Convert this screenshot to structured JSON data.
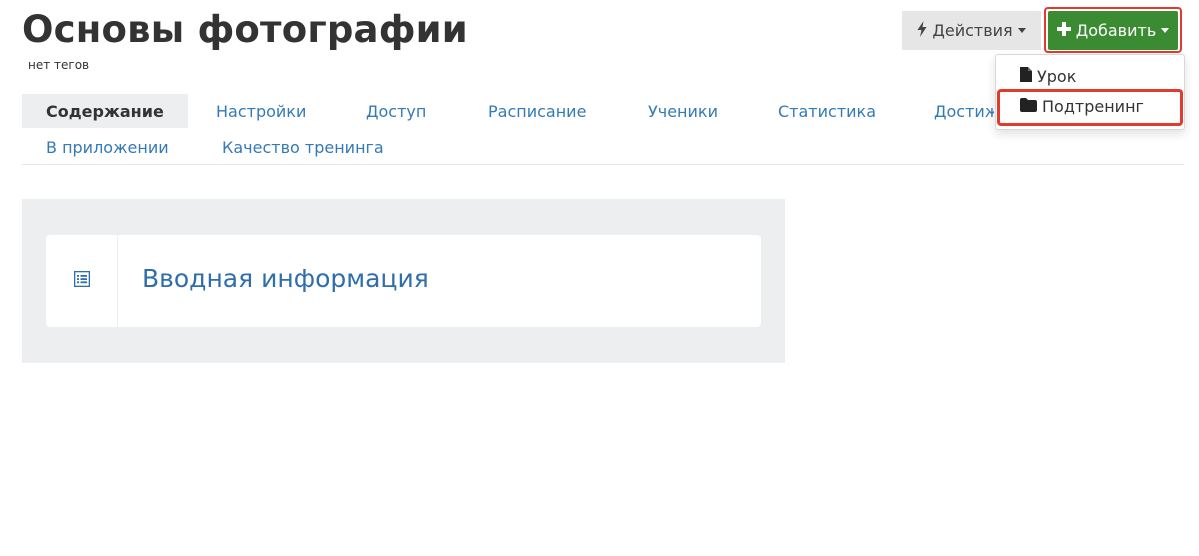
{
  "header": {
    "title": "Основы фотографии",
    "tags": "нет тегов"
  },
  "toolbar": {
    "actions_label": "Действия",
    "add_label": "Добавить",
    "accent_color": "#3b8b33"
  },
  "add_menu": {
    "items": [
      {
        "label": "Урок",
        "icon": "file-icon"
      },
      {
        "label": "Подтренинг",
        "icon": "folder-icon"
      }
    ],
    "highlighted": "Подтренинг"
  },
  "tabs": [
    {
      "label": "Содержание",
      "active": true
    },
    {
      "label": "Настройки"
    },
    {
      "label": "Доступ"
    },
    {
      "label": "Расписание"
    },
    {
      "label": "Ученики"
    },
    {
      "label": "Статистика"
    },
    {
      "label": "Достиж"
    },
    {
      "label": "В приложении"
    },
    {
      "label": "Качество тренинга"
    }
  ],
  "content": {
    "items": [
      {
        "title": "Вводная информация",
        "icon": "list-icon"
      }
    ]
  },
  "colors": {
    "link": "#337ab7",
    "highlight_border": "#e23b2e"
  }
}
